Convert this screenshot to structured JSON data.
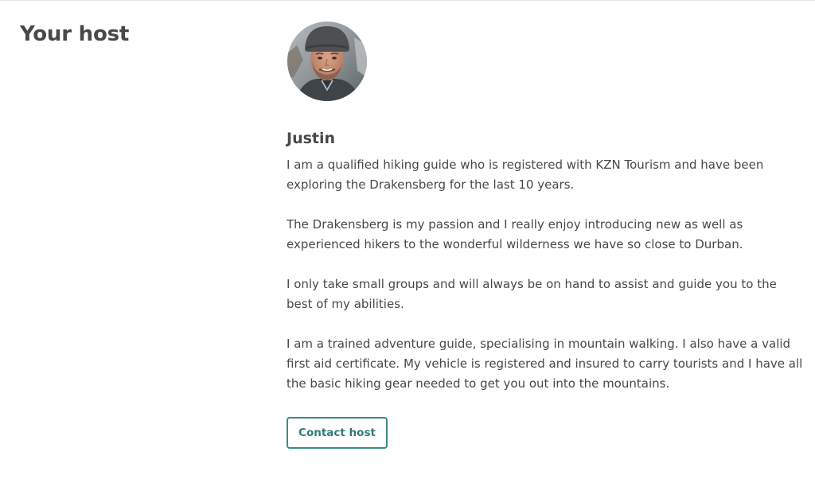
{
  "section": {
    "title": "Your host"
  },
  "host": {
    "name": "Justin",
    "avatar_alt": "Justin",
    "bio": [
      "I am a qualified hiking guide who is registered with KZN Tourism and have been exploring the Drakensberg for the last 10 years.",
      "The Drakensberg is my passion and I really enjoy introducing new as well as experienced hikers to the wonderful wilderness we have so close to Durban.",
      "I only take small groups and will always be on hand to assist and guide you to the best of my abilities.",
      "I am a trained adventure guide, specialising in mountain walking. I also have a valid first aid certificate. My vehicle is registered and insured to carry tourists and I have all the basic hiking gear needed to get you out into the mountains."
    ]
  },
  "actions": {
    "contact_label": "Contact host"
  },
  "colors": {
    "text": "#484848",
    "accent": "#3d8a8a",
    "divider": "#e4e4e4"
  }
}
